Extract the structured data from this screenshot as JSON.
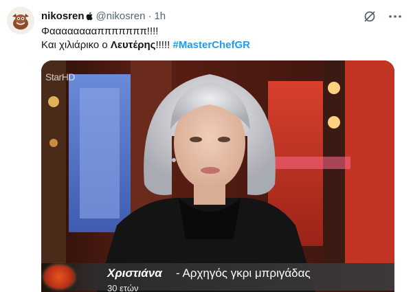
{
  "tweet": {
    "display_name": "nikosren",
    "handle": "@nikosren",
    "separator": "·",
    "time": "1h",
    "text_line1": "Φααααααααπππππππ!!!!",
    "text_line2_prefix": "Και χιλιάρικο ο ",
    "text_line2_bold": "Λευτέρης",
    "text_line2_suffix": "!!!!! ",
    "hashtag": "#MasterChefGR"
  },
  "media": {
    "channel_logo_main": "Star",
    "channel_logo_hd": "HD",
    "caption_name": "Χριστιάνα",
    "caption_role": "- Αρχηγός γκρι μπριγάδας",
    "caption_sub": "30 ετών"
  },
  "icons": [
    "avatar",
    "apple-icon",
    "grok-icon",
    "more-icon"
  ],
  "colors": {
    "accent": "#1d9bf0",
    "text_primary": "#0f1419",
    "text_secondary": "#536471"
  }
}
